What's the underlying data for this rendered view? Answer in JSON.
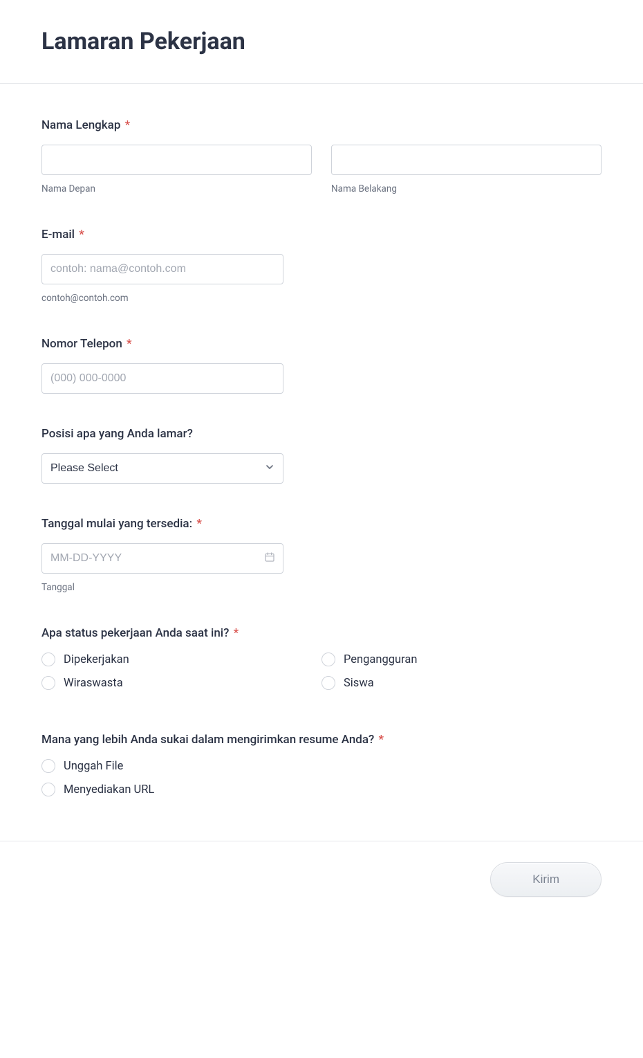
{
  "title": "Lamaran Pekerjaan",
  "fields": {
    "fullname": {
      "label": "Nama Lengkap",
      "required": true,
      "first": {
        "value": "",
        "sublabel": "Nama Depan"
      },
      "last": {
        "value": "",
        "sublabel": "Nama Belakang"
      }
    },
    "email": {
      "label": "E-mail",
      "required": true,
      "placeholder": "contoh: nama@contoh.com",
      "value": "",
      "helper": "contoh@contoh.com"
    },
    "phone": {
      "label": "Nomor Telepon",
      "required": true,
      "placeholder": "(000) 000-0000",
      "value": ""
    },
    "position": {
      "label": "Posisi apa yang Anda lamar?",
      "required": false,
      "selected": "Please Select"
    },
    "start_date": {
      "label": "Tanggal mulai yang tersedia:",
      "required": true,
      "placeholder": "MM-DD-YYYY",
      "value": "",
      "sublabel": "Tanggal"
    },
    "status": {
      "label": "Apa status pekerjaan Anda saat ini?",
      "required": true,
      "options": [
        "Dipekerjakan",
        "Pengangguran",
        "Wiraswasta",
        "Siswa"
      ]
    },
    "resume_pref": {
      "label": "Mana yang lebih Anda sukai dalam mengirimkan resume Anda?",
      "required": true,
      "options": [
        "Unggah File",
        "Menyediakan URL"
      ]
    }
  },
  "required_marker": "*",
  "submit_label": "Kirim"
}
